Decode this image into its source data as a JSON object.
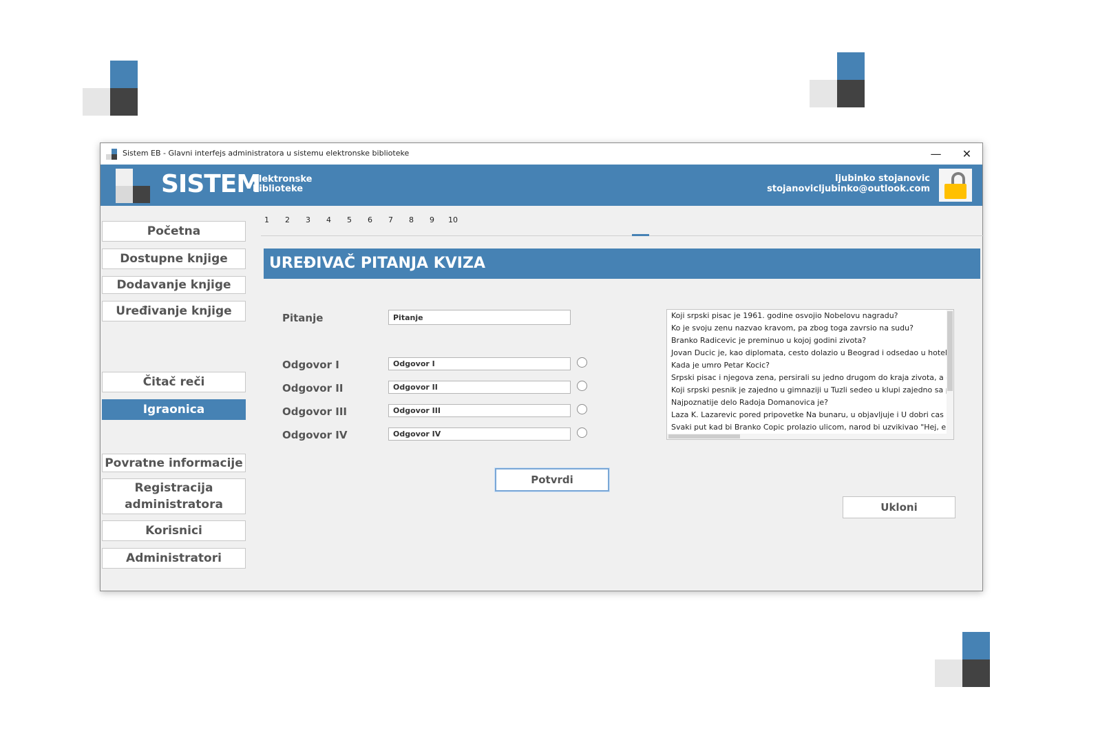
{
  "window": {
    "title": "Sistem EB - Glavni interfejs administratora u sistemu elektronske biblioteke",
    "minimize_glyph": "—",
    "close_glyph": "✕"
  },
  "header": {
    "brand": "SISTEM",
    "brand_sub_line1": "Elektronske",
    "brand_sub_line2": "biblioteke",
    "user_name": "ljubinko stojanovic",
    "user_email": "stojanovicljubinko@outlook.com",
    "lock_icon": "unlocked-padlock-icon"
  },
  "sidebar": {
    "items": [
      {
        "label": "Početna"
      },
      {
        "label": "Dostupne knjige"
      },
      {
        "label": "Dodavanje knjige"
      },
      {
        "label": "Uređivanje knjige"
      },
      {
        "label": "Čitač reči"
      },
      {
        "label": "Igraonica",
        "active": true
      },
      {
        "label": "Povratne informacije"
      },
      {
        "label": "Registracija administratora"
      },
      {
        "label": "Korisnici"
      },
      {
        "label": "Administratori"
      }
    ]
  },
  "tabs": [
    "1",
    "2",
    "3",
    "4",
    "5",
    "6",
    "7",
    "8",
    "9",
    "10",
    ""
  ],
  "editor": {
    "title": "UREĐIVAČ PITANJA KVIZA",
    "question_label": "Pitanje",
    "question_value": "Pitanje",
    "answers": [
      {
        "label": "Odgovor I",
        "value": "Odgovor I"
      },
      {
        "label": "Odgovor II",
        "value": "Odgovor II"
      },
      {
        "label": "Odgovor III",
        "value": "Odgovor III"
      },
      {
        "label": "Odgovor IV",
        "value": "Odgovor IV"
      }
    ],
    "confirm_label": "Potvrdi",
    "remove_label": "Ukloni"
  },
  "questions": [
    "Koji srpski pisac je 1961. godine osvojio Nobelovu nagradu?",
    "Ko je svoju zenu nazvao kravom, pa zbog toga zavrsio na sudu?",
    "Branko Radicevic je preminuo u kojoj godini zivota?",
    "Jovan Ducic je, kao diplomata, cesto dolazio u Beograd i odsedao u hotelu...",
    "Kada je umro Petar Kocic?",
    "Srpski pisac i njegova zena, persirali su jedno drugom do kraja zivota, a ona",
    "Koji srpski pesnik je zajedno u gimnaziji u Tuzli sedeo u klupi zajedno sa patr",
    "Najpoznatije delo Radoja Domanovica je?",
    "Laza K. Lazarevic pored pripovetke Na bunaru, u objavljuje i U dobri cas hajd",
    "Svaki put kad bi Branko Copic prolazio ulicom, narod bi uzvikivao \"Hej, eno"
  ]
}
